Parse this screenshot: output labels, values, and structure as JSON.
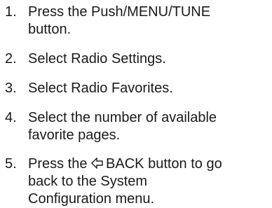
{
  "steps": [
    {
      "number": "1.",
      "lines": [
        "Press the Push/MENU/TUNE",
        "button."
      ]
    },
    {
      "number": "2.",
      "lines": [
        "Select Radio Settings."
      ]
    },
    {
      "number": "3.",
      "lines": [
        "Select Radio Favorites."
      ]
    },
    {
      "number": "4.",
      "lines": [
        "Select the number of available",
        "favorite pages."
      ]
    },
    {
      "number": "5.",
      "line1_before": "Press the",
      "icon": "back-arrow-icon",
      "line1_after": "BACK button to go",
      "lines_rest": [
        "back to the System",
        "Configuration menu."
      ]
    }
  ]
}
